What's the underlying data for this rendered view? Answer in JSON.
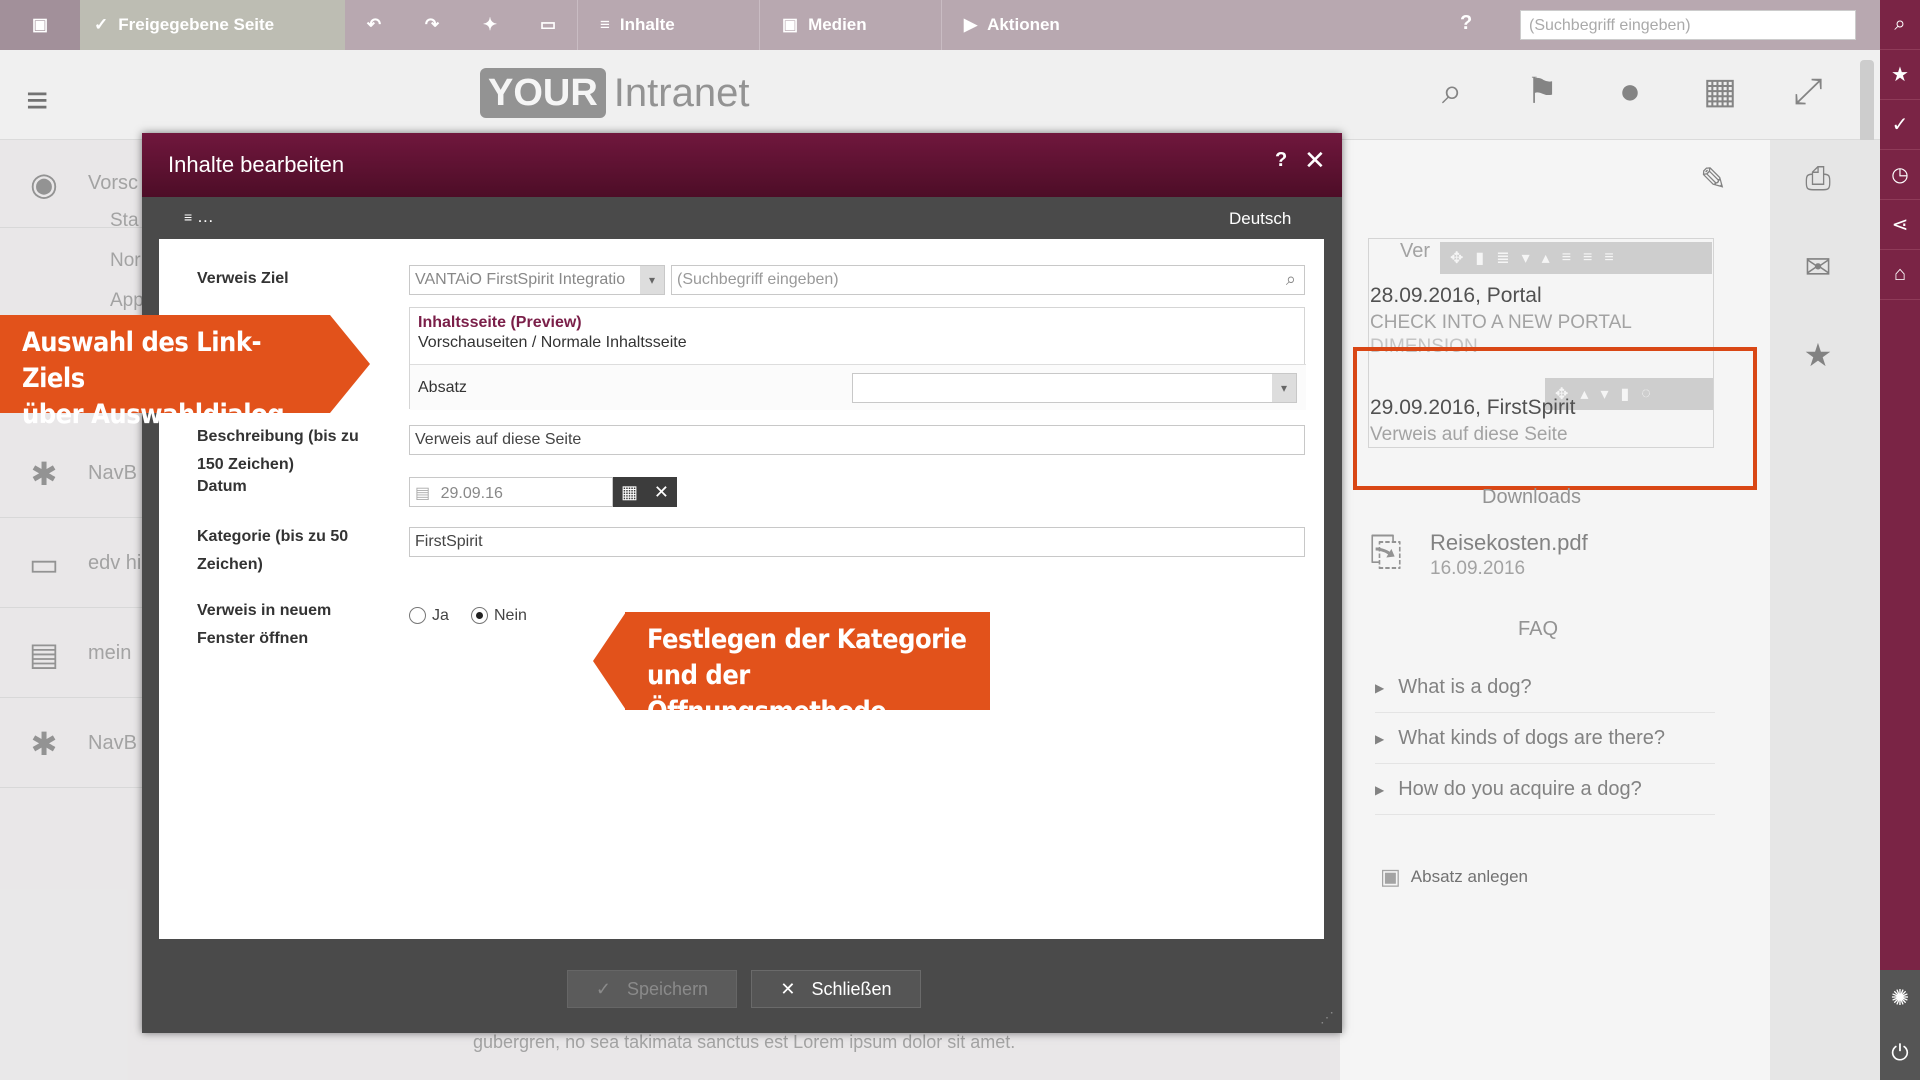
{
  "toolbar": {
    "released_label": "Freigegebene Seite",
    "menu_inhalte": "Inhalte",
    "menu_medien": "Medien",
    "menu_aktionen": "Aktionen",
    "help": "?",
    "search_placeholder": "(Suchbegriff eingeben)"
  },
  "header": {
    "logo_your": "YOUR",
    "logo_intranet": "Intranet"
  },
  "sidebar": {
    "items": [
      {
        "label": "Vorsc",
        "icon": "eye-icon"
      },
      {
        "label": "Sta"
      },
      {
        "label": "Nor"
      },
      {
        "label": "App"
      },
      {
        "label": "NavB",
        "icon": "bug-icon"
      },
      {
        "label": "edv hi",
        "icon": "monitor-icon"
      },
      {
        "label": "mein",
        "icon": "building-icon"
      },
      {
        "label": "NavB",
        "icon": "bug-icon"
      }
    ]
  },
  "right": {
    "card_title": "Ver",
    "news1_date": "28.09.2016, Portal",
    "news1_sub": "CHECK INTO A NEW PORTAL",
    "news1_sub2": "DIMENSION",
    "news2_date": "29.09.2016, FirstSpirit",
    "news2_sub": "Verweis auf diese Seite",
    "downloads_title": "Downloads",
    "download_file": "Reisekosten.pdf",
    "download_date": "16.09.2016",
    "faq_title": "FAQ",
    "faq_items": [
      "What is a dog?",
      "What kinds of dogs are there?",
      "How do you acquire a dog?"
    ],
    "absatz_anlegen": "Absatz anlegen"
  },
  "dialog": {
    "title": "Inhalte bearbeiten",
    "help": "?",
    "menu": "…",
    "language": "Deutsch",
    "fields": {
      "verweis_ziel_label": "Verweis Ziel",
      "project_select": "VANTAiO FirstSpirit Integratio",
      "search_placeholder": "(Suchbegriff eingeben)",
      "ref_title": "Inhaltsseite (Preview)",
      "ref_path": "Vorschauseiten / Normale Inhaltsseite",
      "absatz_label": "Absatz",
      "absatz_value": "",
      "beschreibung_label": "Beschreibung (bis zu 150 Zeichen)",
      "beschreibung_value": "Verweis auf diese Seite",
      "datum_label": "Datum",
      "datum_value": "29.09.16",
      "kategorie_label": "Kategorie (bis zu 50 Zeichen)",
      "kategorie_value": "FirstSpirit",
      "fenster_label": "Verweis in neuem Fenster öffnen",
      "radio_ja": "Ja",
      "radio_nein": "Nein",
      "radio_selected": "Nein"
    },
    "save_label": "Speichern",
    "close_label": "Schließen"
  },
  "callouts": {
    "link_target_line1": "Auswahl des Link-Ziels",
    "link_target_line2": "über Auswahldialog",
    "category_line1": "Festlegen der Kategorie",
    "category_line2": "und der Öffnungsmethode"
  },
  "background_text": "gubergren, no sea takimata sanctus est Lorem ipsum dolor sit amet.",
  "colors": {
    "accent": "#7a2445",
    "callout": "#e2521b",
    "dialog_title": "#5e1233"
  }
}
